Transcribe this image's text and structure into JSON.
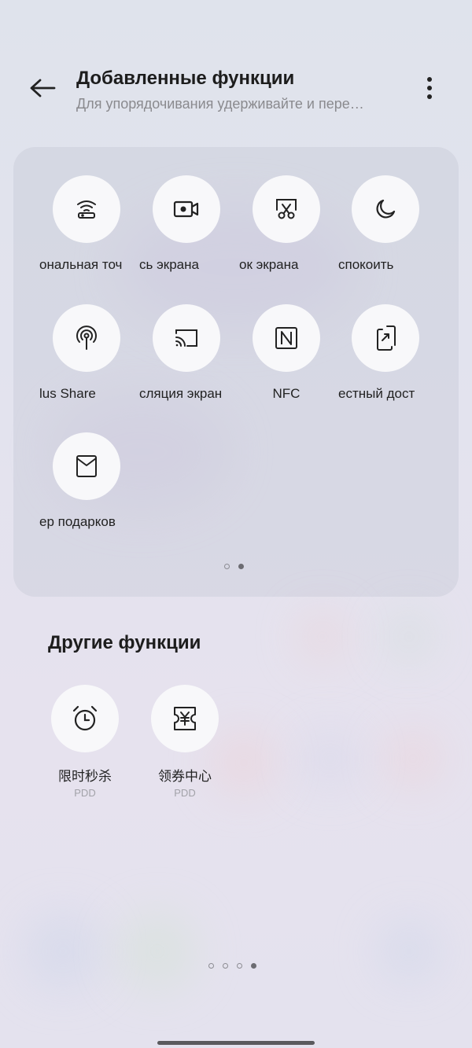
{
  "header": {
    "title": "Добавленные функции",
    "subtitle": "Для упорядочивания удерживайте и пере…"
  },
  "added_functions": {
    "tiles": [
      {
        "label": "ональная точ",
        "icon": "hotspot-icon"
      },
      {
        "label": "сь экрана",
        "icon": "screen-record-icon"
      },
      {
        "label": "ок экрана",
        "icon": "screenshot-icon"
      },
      {
        "label": "спокоить",
        "icon": "moon-icon"
      },
      {
        "label": "lus Share",
        "icon": "share-antenna-icon"
      },
      {
        "label": "сляция экран",
        "icon": "cast-icon"
      },
      {
        "label": "NFC",
        "icon": "nfc-icon"
      },
      {
        "label": "естный дост",
        "icon": "phone-share-icon"
      },
      {
        "label": "ер подарков",
        "icon": "envelope-icon"
      }
    ],
    "page_indicator": {
      "count": 2,
      "active": 2
    }
  },
  "other_functions": {
    "title": "Другие функции",
    "tiles": [
      {
        "label": "限时秒杀",
        "sub": "PDD",
        "icon": "alarm-clock-icon"
      },
      {
        "label": "领券中心",
        "sub": "PDD",
        "icon": "coupon-icon"
      }
    ]
  },
  "bottom_page_indicator": {
    "count": 4,
    "active": 4
  }
}
